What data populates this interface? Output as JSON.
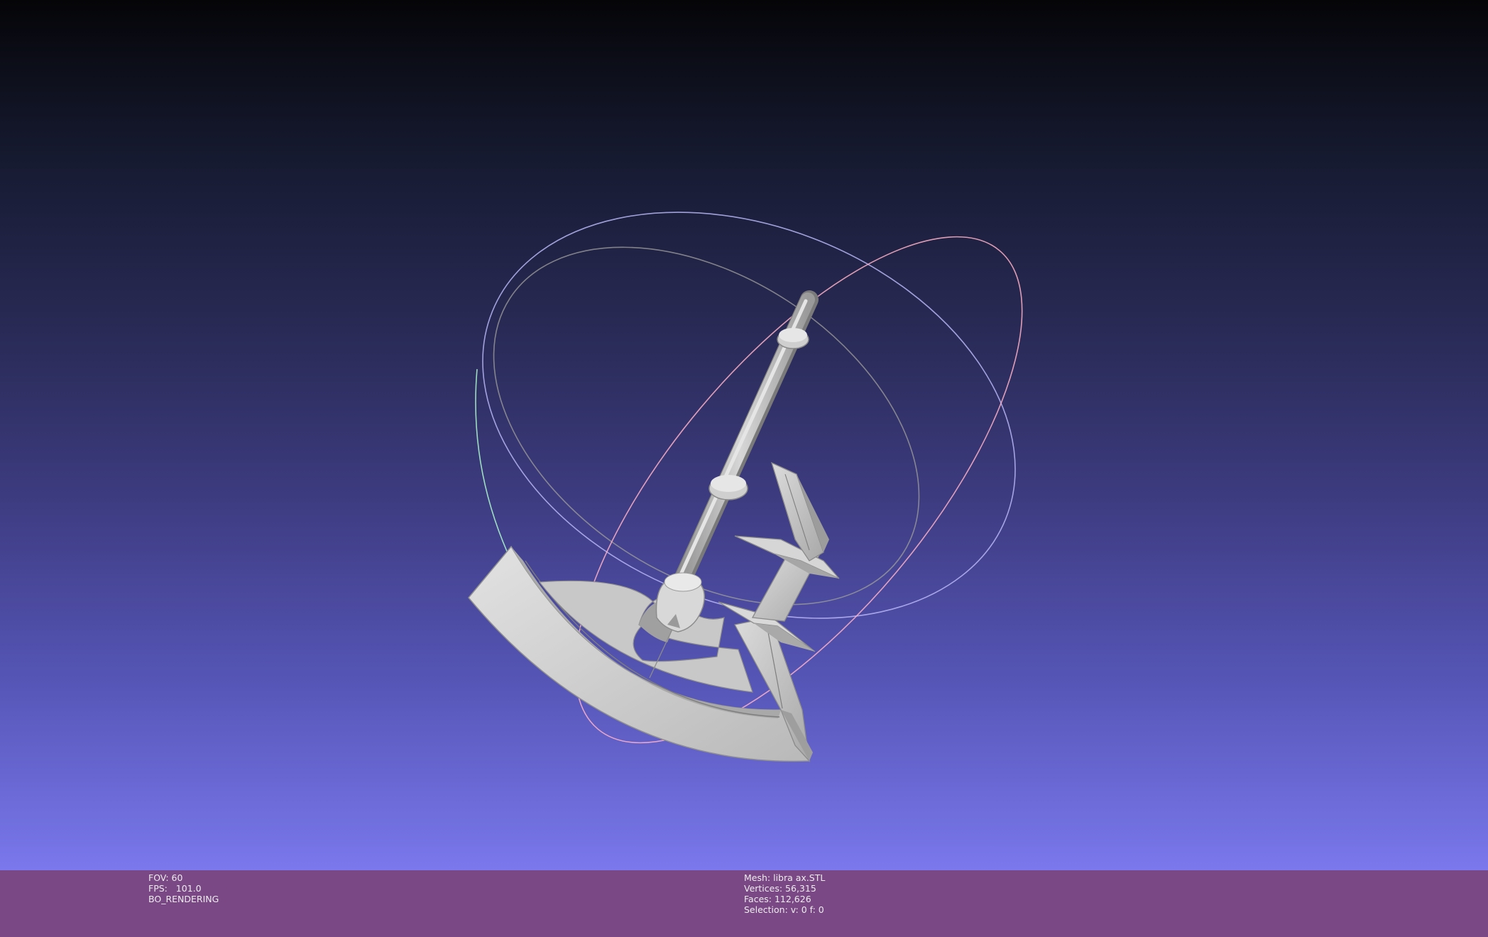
{
  "viewer": {
    "background_top": "#050508",
    "background_bottom": "#7a78ec",
    "info_bar_color": "#7b4886"
  },
  "info_left": {
    "fov": "FOV: 60",
    "fps": "FPS:   101.0",
    "mode": "BO_RENDERING"
  },
  "info_right": {
    "mesh": "Mesh: libra ax.STL",
    "vertices": "Vertices: 56,315",
    "faces": "Faces: 112,626",
    "selection": "Selection: v: 0 f: 0"
  },
  "scene": {
    "object": "axe-mesh",
    "trackball": "trackball-gizmo"
  }
}
